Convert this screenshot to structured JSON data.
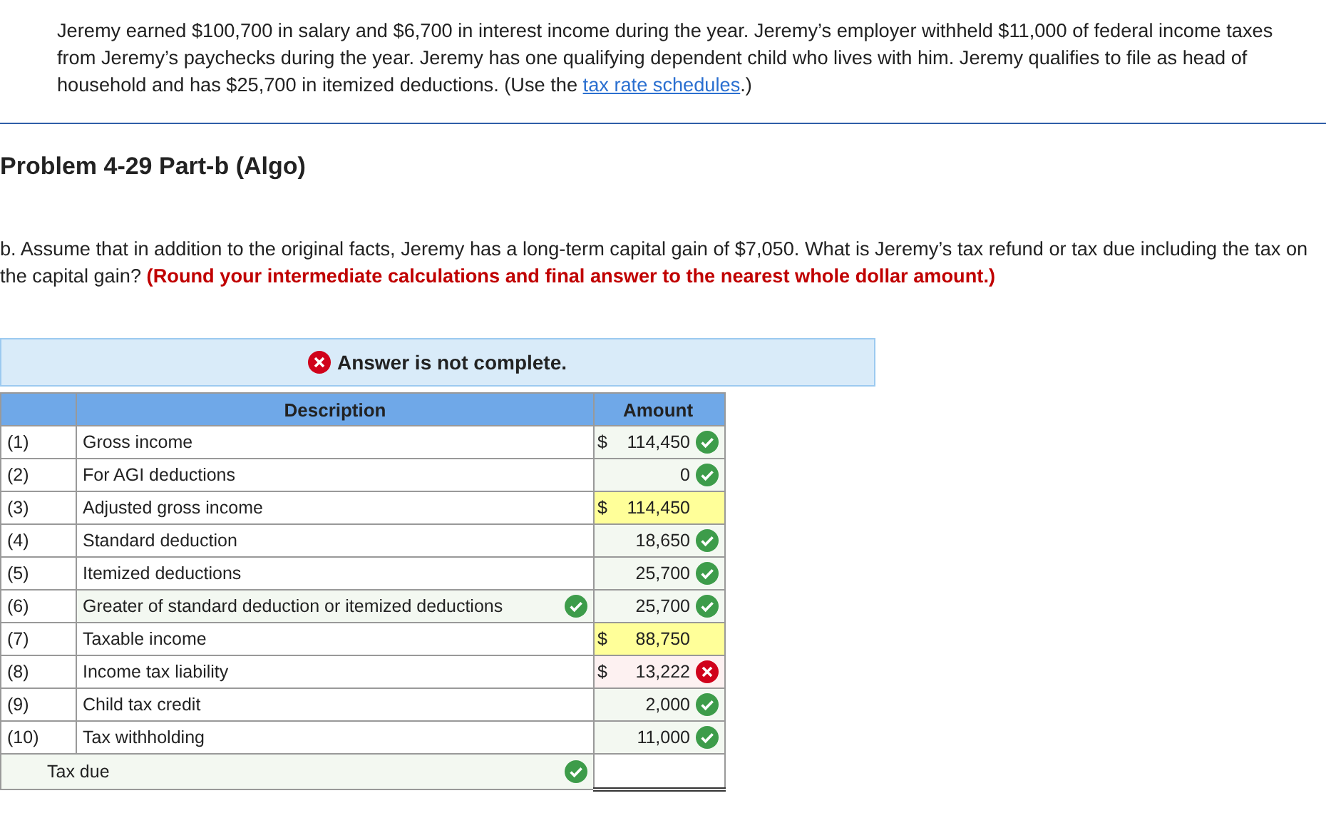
{
  "intro": {
    "text": "Jeremy earned $100,700 in salary and $6,700 in interest income during the year. Jeremy’s employer withheld $11,000 of federal income taxes from Jeremy’s paychecks during the year. Jeremy has one qualifying dependent child who lives with him. Jeremy qualifies to file as head of household and has $25,700 in itemized deductions. (Use the ",
    "link": "tax rate schedules",
    "after": ".)"
  },
  "problem_title": "Problem 4-29 Part-b (Algo)",
  "question": {
    "text": "b. Assume that in addition to the original facts, Jeremy has a long-term capital gain of $7,050. What is Jeremy’s tax refund or tax due including the tax on the capital gain? ",
    "instruction": "(Round your intermediate calculations and final answer to the nearest whole dollar amount.)"
  },
  "banner": {
    "text": "Answer is not complete.",
    "complete": false
  },
  "table": {
    "columns": [
      "Description",
      "Amount"
    ],
    "rows": [
      {
        "kind": "graded",
        "number": "(1)",
        "description": "Gross income",
        "currency": "$",
        "amount": "114,450",
        "correct": true
      },
      {
        "kind": "graded",
        "number": "(2)",
        "description": "For AGI deductions",
        "amount": "0",
        "correct": true
      },
      {
        "kind": "ungraded",
        "number": "(3)",
        "description": "Adjusted gross income",
        "currency": "$",
        "amount": "114,450"
      },
      {
        "kind": "graded",
        "number": "(4)",
        "description": "Standard deduction",
        "amount": "18,650",
        "correct": true
      },
      {
        "kind": "graded",
        "number": "(5)",
        "description": "Itemized deductions",
        "amount": "25,700",
        "correct": true
      },
      {
        "kind": "choice",
        "number": "(6)",
        "description": "Greater of standard deduction or itemized deductions",
        "description_correct": true,
        "amount": "25,700",
        "correct": true
      },
      {
        "kind": "ungraded",
        "number": "(7)",
        "description": "Taxable income",
        "currency": "$",
        "amount": "88,750"
      },
      {
        "kind": "graded",
        "number": "(8)",
        "description": "Income tax liability",
        "currency": "$",
        "amount": "13,222",
        "correct": false
      },
      {
        "kind": "graded",
        "number": "(9)",
        "description": "Child tax credit",
        "amount": "2,000",
        "correct": true
      },
      {
        "kind": "graded",
        "number": "(10)",
        "description": "Tax withholding",
        "amount": "11,000",
        "correct": true
      }
    ],
    "total": {
      "label": "Tax due",
      "label_correct": true
    }
  }
}
